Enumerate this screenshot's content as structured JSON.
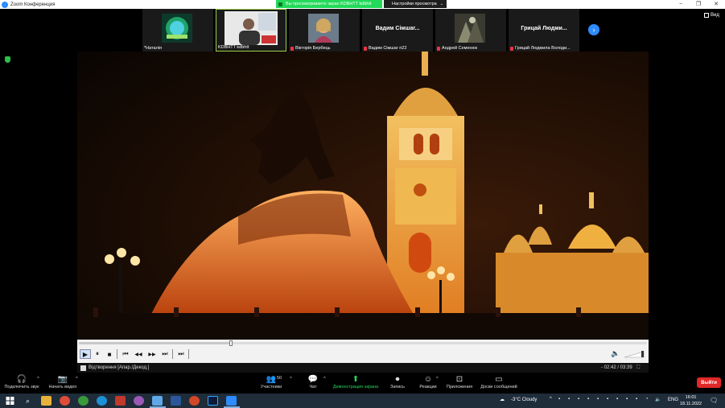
{
  "window": {
    "title": "Zoom Конференция",
    "share_banner": "Вы просматриваете экран KDBHTT kdbhtt",
    "view_settings": "Настройки просмотра",
    "controls": {
      "minimize": "−",
      "restore": "❐",
      "close": "✕"
    }
  },
  "gallery": {
    "participants": [
      {
        "name": "*Наталія",
        "display": "image",
        "muted": false
      },
      {
        "name": "KDBHTT kdbhtt",
        "display": "video",
        "muted": false,
        "active": true
      },
      {
        "name": "Вікторія Бербець",
        "display": "video",
        "muted": true
      },
      {
        "name": "Вадим Сімшаг п22",
        "display": "name",
        "big_name": "Вадим Сімшаг...",
        "muted": true
      },
      {
        "name": "Андрей Семенюк",
        "display": "image",
        "muted": true
      },
      {
        "name": "Грицай Людмила Володи...",
        "display": "name",
        "big_name": "Грицай Людми...",
        "muted": true
      }
    ],
    "next_icon": "›",
    "view_label": "Вид"
  },
  "player": {
    "progress": 0.268,
    "status_text": "Відтворення [Апар./Декод.]",
    "time": "- 02:42 / 03:39",
    "buttons": {
      "play": "▶",
      "pause": "⏸",
      "stop": "■",
      "prev": "⏮",
      "rewind": "◀◀",
      "forward": "▶▶",
      "next": "⏭",
      "frame": "⏭"
    },
    "volume_icon": "🔈"
  },
  "toolbar": {
    "audio": "Подключить звук",
    "video": "Начать видео",
    "participants": "Участники",
    "participants_count": "50",
    "chat": "Чат",
    "share": "Демонстрация экрана",
    "record": "Запись",
    "reactions": "Реакции",
    "apps": "Приложения",
    "whiteboards": "Доски сообщений",
    "exit": "Выйти"
  },
  "taskbar": {
    "weather": "-3°C  Cloudy",
    "lang": "ENG",
    "time": "16:01",
    "date": "18.11.2022"
  },
  "colors": {
    "zoom_blue": "#2d8cff",
    "share_green": "#23d959",
    "exit_red": "#e02828",
    "taskbar": "#1f2c3a"
  }
}
